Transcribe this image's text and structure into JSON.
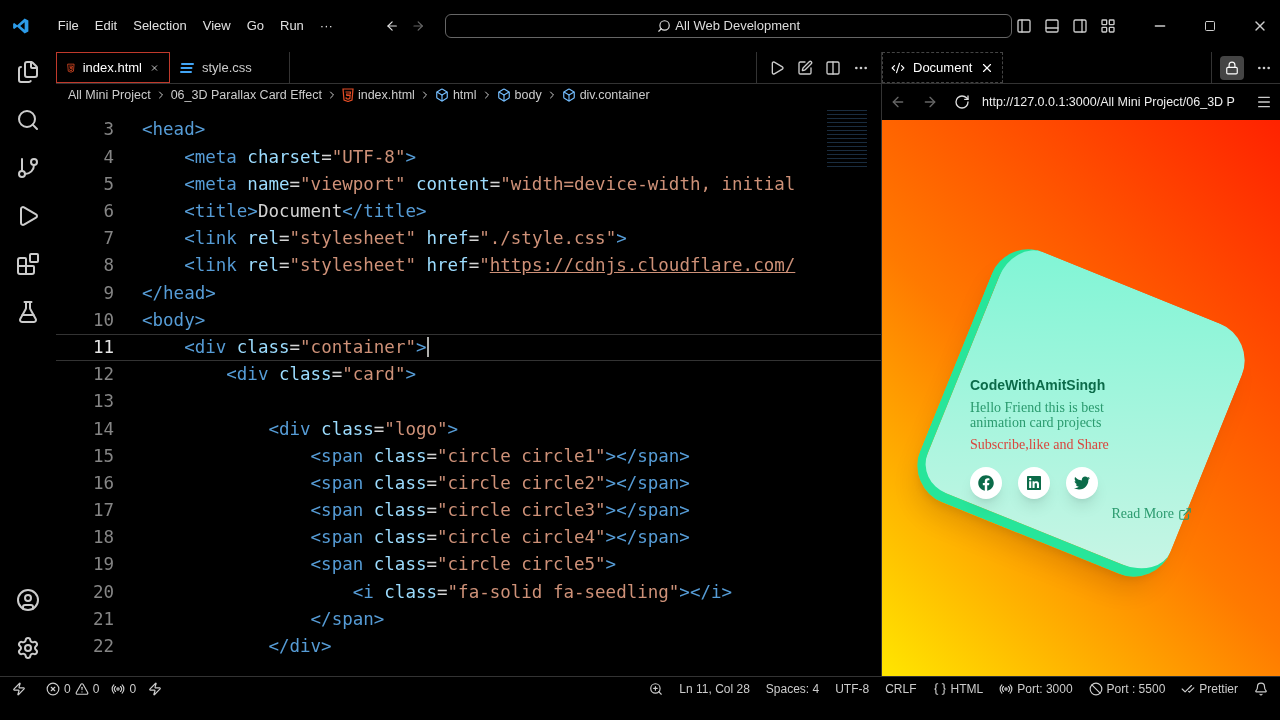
{
  "menu": [
    "File",
    "Edit",
    "Selection",
    "View",
    "Go",
    "Run",
    "···"
  ],
  "command_center": {
    "text": "All Web Development"
  },
  "editor_tabs": [
    {
      "label": "index.html",
      "kind": "html",
      "selected": true
    },
    {
      "label": "style.css",
      "kind": "css",
      "selected": false
    }
  ],
  "breadcrumbs": [
    {
      "label": "All Mini Project",
      "kind": "folder"
    },
    {
      "label": "06_3D Parallax Card Effect",
      "kind": "folder"
    },
    {
      "label": "index.html",
      "kind": "html"
    },
    {
      "label": "html",
      "kind": "element"
    },
    {
      "label": "body",
      "kind": "element"
    },
    {
      "label": "div.container",
      "kind": "element"
    }
  ],
  "code_lines": [
    {
      "number": "3",
      "current": false,
      "tokens": [
        {
          "kind": "tag",
          "text": "<head>"
        }
      ]
    },
    {
      "number": "4",
      "current": false,
      "tokens": [
        {
          "kind": "tag",
          "text": "    <meta"
        },
        {
          "kind": "attr",
          "text": " charset"
        },
        {
          "kind": "plain",
          "text": "="
        },
        {
          "kind": "string",
          "text": "\"UTF-8\""
        },
        {
          "kind": "tag",
          "text": ">"
        }
      ]
    },
    {
      "number": "5",
      "current": false,
      "tokens": [
        {
          "kind": "tag",
          "text": "    <meta"
        },
        {
          "kind": "attr",
          "text": " name"
        },
        {
          "kind": "plain",
          "text": "="
        },
        {
          "kind": "string",
          "text": "\"viewport\""
        },
        {
          "kind": "attr",
          "text": " content"
        },
        {
          "kind": "plain",
          "text": "="
        },
        {
          "kind": "string",
          "text": "\"width=device-width, initial"
        }
      ]
    },
    {
      "number": "6",
      "current": false,
      "tokens": [
        {
          "kind": "tag",
          "text": "    <title>"
        },
        {
          "kind": "plain",
          "text": "Document"
        },
        {
          "kind": "tag",
          "text": "</title>"
        }
      ]
    },
    {
      "number": "7",
      "current": false,
      "tokens": [
        {
          "kind": "tag",
          "text": "    <link"
        },
        {
          "kind": "attr",
          "text": " rel"
        },
        {
          "kind": "plain",
          "text": "="
        },
        {
          "kind": "string",
          "text": "\"stylesheet\""
        },
        {
          "kind": "attr",
          "text": " href"
        },
        {
          "kind": "plain",
          "text": "="
        },
        {
          "kind": "string",
          "text": "\"./style.css\""
        },
        {
          "kind": "tag",
          "text": ">"
        }
      ]
    },
    {
      "number": "8",
      "current": false,
      "tokens": [
        {
          "kind": "tag",
          "text": "    <link"
        },
        {
          "kind": "attr",
          "text": " rel"
        },
        {
          "kind": "plain",
          "text": "="
        },
        {
          "kind": "string",
          "text": "\"stylesheet\""
        },
        {
          "kind": "attr",
          "text": " href"
        },
        {
          "kind": "plain",
          "text": "="
        },
        {
          "kind": "string",
          "text": "\""
        },
        {
          "kind": "url",
          "text": "https://cdnjs.cloudflare.com/"
        }
      ]
    },
    {
      "number": "9",
      "current": false,
      "tokens": [
        {
          "kind": "tag",
          "text": "</head>"
        }
      ]
    },
    {
      "number": "10",
      "current": false,
      "tokens": [
        {
          "kind": "tag",
          "text": "<body>"
        }
      ]
    },
    {
      "number": "11",
      "current": true,
      "tokens": [
        {
          "kind": "tag",
          "text": "    <div"
        },
        {
          "kind": "attr",
          "text": " class"
        },
        {
          "kind": "plain",
          "text": "="
        },
        {
          "kind": "string",
          "text": "\"container\""
        },
        {
          "kind": "tag",
          "text": ">"
        }
      ]
    },
    {
      "number": "12",
      "current": false,
      "tokens": [
        {
          "kind": "tag",
          "text": "        <div"
        },
        {
          "kind": "attr",
          "text": " class"
        },
        {
          "kind": "plain",
          "text": "="
        },
        {
          "kind": "string",
          "text": "\"card\""
        },
        {
          "kind": "tag",
          "text": ">"
        }
      ]
    },
    {
      "number": "13",
      "current": false
    },
    {
      "number": "14",
      "current": false,
      "tokens": [
        {
          "kind": "tag",
          "text": "            <div"
        },
        {
          "kind": "attr",
          "text": " class"
        },
        {
          "kind": "plain",
          "text": "="
        },
        {
          "kind": "string",
          "text": "\"logo\""
        },
        {
          "kind": "tag",
          "text": ">"
        }
      ]
    },
    {
      "number": "15",
      "current": false,
      "tokens": [
        {
          "kind": "tag",
          "text": "                <span"
        },
        {
          "kind": "attr",
          "text": " class"
        },
        {
          "kind": "plain",
          "text": "="
        },
        {
          "kind": "string",
          "text": "\"circle circle1\""
        },
        {
          "kind": "tag",
          "text": "></span>"
        }
      ]
    },
    {
      "number": "16",
      "current": false,
      "tokens": [
        {
          "kind": "tag",
          "text": "                <span"
        },
        {
          "kind": "attr",
          "text": " class"
        },
        {
          "kind": "plain",
          "text": "="
        },
        {
          "kind": "string",
          "text": "\"circle circle2\""
        },
        {
          "kind": "tag",
          "text": "></span>"
        }
      ]
    },
    {
      "number": "17",
      "current": false,
      "tokens": [
        {
          "kind": "tag",
          "text": "                <span"
        },
        {
          "kind": "attr",
          "text": " class"
        },
        {
          "kind": "plain",
          "text": "="
        },
        {
          "kind": "string",
          "text": "\"circle circle3\""
        },
        {
          "kind": "tag",
          "text": "></span>"
        }
      ]
    },
    {
      "number": "18",
      "current": false,
      "tokens": [
        {
          "kind": "tag",
          "text": "                <span"
        },
        {
          "kind": "attr",
          "text": " class"
        },
        {
          "kind": "plain",
          "text": "="
        },
        {
          "kind": "string",
          "text": "\"circle circle4\""
        },
        {
          "kind": "tag",
          "text": "></span>"
        }
      ]
    },
    {
      "number": "19",
      "current": false,
      "tokens": [
        {
          "kind": "tag",
          "text": "                <span"
        },
        {
          "kind": "attr",
          "text": " class"
        },
        {
          "kind": "plain",
          "text": "="
        },
        {
          "kind": "string",
          "text": "\"circle circle5\""
        },
        {
          "kind": "tag",
          "text": ">"
        }
      ]
    },
    {
      "number": "20",
      "current": false,
      "tokens": [
        {
          "kind": "tag",
          "text": "                    <i"
        },
        {
          "kind": "attr",
          "text": " class"
        },
        {
          "kind": "plain",
          "text": "="
        },
        {
          "kind": "string",
          "text": "\"fa-solid fa-seedling\""
        },
        {
          "kind": "tag",
          "text": "></i>"
        }
      ]
    },
    {
      "number": "21",
      "current": false,
      "tokens": [
        {
          "kind": "tag",
          "text": "                </span>"
        }
      ]
    },
    {
      "number": "22",
      "current": false,
      "tokens": [
        {
          "kind": "tag",
          "text": "            </div>"
        }
      ]
    }
  ],
  "browser": {
    "tab": "Document",
    "url": "http://127.0.0.1:3000/All Mini Project/06_3D P",
    "card": {
      "title": "CodeWithAmitSingh",
      "text": "Hello Friend this is best animation card projects",
      "cta": "Subscribe,like and Share",
      "socials": [
        {
          "kind": "facebook"
        },
        {
          "kind": "linkedin"
        },
        {
          "kind": "twitter"
        }
      ],
      "link": "Read More"
    }
  },
  "status_bar": {
    "errors": "0",
    "warnings": "0",
    "ports": "0",
    "items": [
      "Ln 11, Col 28",
      "Spaces: 4",
      "UTF-8",
      "CRLF",
      "HTML",
      "Port: 3000",
      "Port : 5500",
      "Prettier"
    ]
  }
}
